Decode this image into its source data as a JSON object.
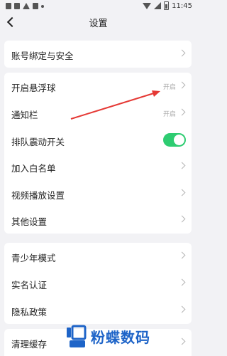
{
  "status_bar": {
    "time": "11:45"
  },
  "header": {
    "title": "设置"
  },
  "groups": [
    {
      "items": [
        {
          "label": "账号绑定与安全"
        }
      ]
    },
    {
      "items": [
        {
          "label": "开启悬浮球",
          "status": "开启"
        },
        {
          "label": "通知栏",
          "status": "开启"
        },
        {
          "label": "排队震动开关",
          "toggle": true
        },
        {
          "label": "加入白名单"
        },
        {
          "label": "视频播放设置"
        },
        {
          "label": "其他设置"
        }
      ]
    },
    {
      "items": [
        {
          "label": "青少年模式"
        },
        {
          "label": "实名认证"
        },
        {
          "label": "隐私政策"
        }
      ]
    },
    {
      "items": [
        {
          "label": "清理缓存"
        }
      ]
    }
  ],
  "colors": {
    "accent": "#2ecc71",
    "annotation": "#e53935",
    "watermark": "#1e64c8"
  },
  "watermark": {
    "text": "粉蝶数码"
  }
}
